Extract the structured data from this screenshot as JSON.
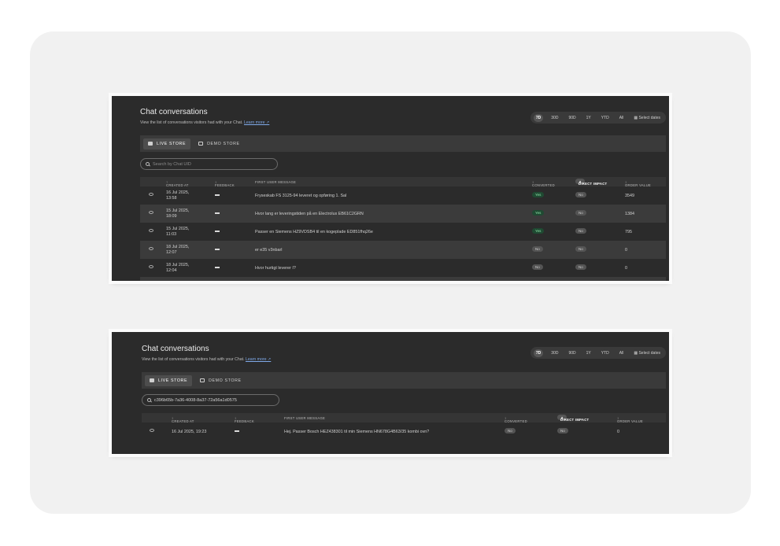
{
  "panels": [
    {
      "title": "Chat conversations",
      "subtitle": "View the list of conversations visitors had with your Chat.",
      "learn_more": "Learn more",
      "ranges": [
        "7D",
        "30D",
        "90D",
        "1Y",
        "YTD",
        "All"
      ],
      "select_dates": "Select dates",
      "tabs": [
        "LIVE STORE",
        "DEMO STORE"
      ],
      "search_placeholder": "Search by Chat UID",
      "search_value": "",
      "columns": [
        "CREATED AT",
        "FEEDBACK",
        "FIRST USER MESSAGE",
        "CONVERTED",
        "DIRECT IMPACT",
        "ORDER VALUE"
      ],
      "rows": [
        {
          "created": [
            "16 Jul 2025,",
            "13:58"
          ],
          "feedback": "—",
          "message": "Fryseskab FS 3125-94 leveret og opføring 1. Sal",
          "converted": "Yes",
          "impact": "No",
          "order_value": "3549"
        },
        {
          "created": [
            "15 Jul 2025,",
            "18:09"
          ],
          "feedback": "—",
          "message": "Hvor lang er leveringstiden på en Electrolux EB61C2GRN",
          "converted": "Yes",
          "impact": "No",
          "order_value": "1384"
        },
        {
          "created": [
            "15 Jul 2025,",
            "11:03"
          ],
          "feedback": "—",
          "message": "Passer en Siemens HZ9VDSB4 til en kogeplade ED851fhq26e",
          "converted": "Yes",
          "impact": "No",
          "order_value": "795"
        },
        {
          "created": [
            "18 Jul 2025,",
            "12:07"
          ],
          "feedback": "—",
          "message": "er e35 v3nbarl",
          "converted": "No",
          "impact": "No",
          "order_value": "0"
        },
        {
          "created": [
            "18 Jul 2025,",
            "12:04"
          ],
          "feedback": "—",
          "message": "Hvor hurtigt leverer I?",
          "converted": "No",
          "impact": "No",
          "order_value": "0"
        }
      ]
    },
    {
      "title": "Chat conversations",
      "subtitle": "View the list of conversations visitors had with your Chat.",
      "learn_more": "Learn more",
      "ranges": [
        "7D",
        "30D",
        "90D",
        "1Y",
        "YTD",
        "All"
      ],
      "select_dates": "Select dates",
      "tabs": [
        "LIVE STORE",
        "DEMO STORE"
      ],
      "search_placeholder": "",
      "search_value": "c396b65b-7a36-4008-8a37-72a56a1d0575",
      "columns": [
        "CREATED AT",
        "FEEDBACK",
        "FIRST USER MESSAGE",
        "CONVERTED",
        "DIRECT IMPACT",
        "ORDER VALUE"
      ],
      "rows": [
        {
          "created": [
            "16 Jul 2025, 19:23"
          ],
          "feedback": "—",
          "message": "Hej. Passer Bosch HEZ438301 til min Siemens HN678G4B63/35 kombi ovn?",
          "converted": "No",
          "impact": "No",
          "order_value": "0"
        }
      ]
    }
  ],
  "colors": {
    "panel_bg": "#2b2b2b",
    "accent_link": "#7fa9e8",
    "yes_pill": "#1f4a32"
  }
}
